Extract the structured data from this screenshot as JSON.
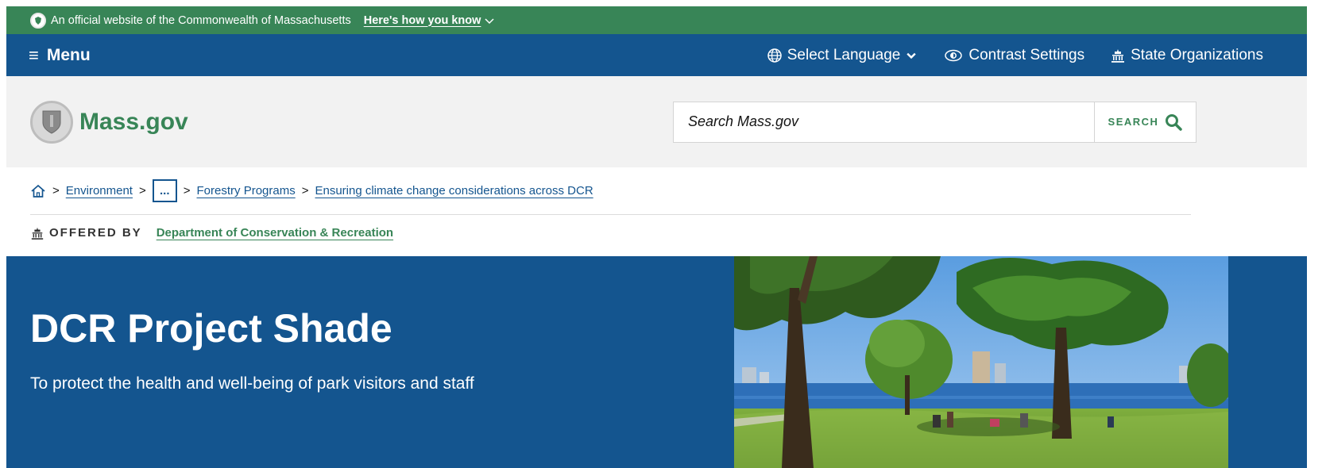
{
  "official_banner": {
    "text": "An official website of the Commonwealth of Massachusetts",
    "link": "Here's how you know"
  },
  "utility_nav": {
    "menu_label": "Menu",
    "language_label": "Select Language",
    "contrast_label": "Contrast Settings",
    "state_orgs_label": "State Organizations"
  },
  "header": {
    "logo_text": "Mass.gov",
    "search_placeholder": "Search Mass.gov",
    "search_button": "SEARCH"
  },
  "breadcrumb": {
    "items": [
      "Environment",
      "...",
      "Forestry Programs",
      "Ensuring climate change considerations across DCR"
    ]
  },
  "offered_by": {
    "label": "OFFERED BY",
    "org": "Department of Conservation & Recreation"
  },
  "hero": {
    "title": "DCR Project Shade",
    "subtitle": "To protect the health and well-being of park visitors and staff"
  },
  "colors": {
    "green": "#388557",
    "blue": "#14558f",
    "header_bg": "#f2f2f2"
  }
}
